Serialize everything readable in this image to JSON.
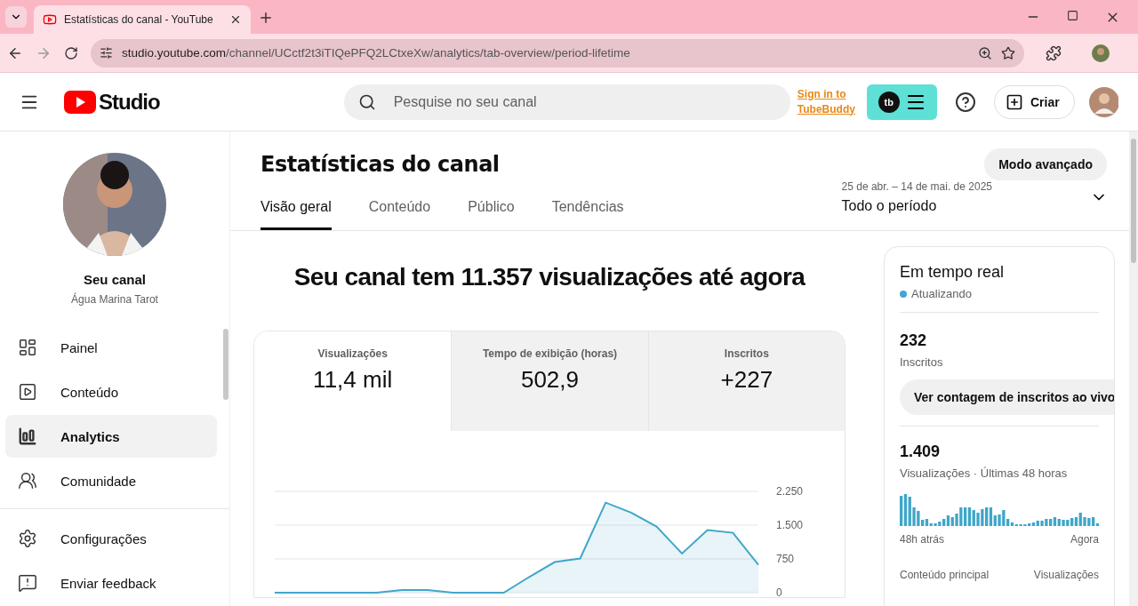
{
  "browser": {
    "tab_title": "Estatísticas do canal - YouTube",
    "url_host": "studio.youtube.com",
    "url_path": "/channel/UCctf2t3iTIQePFQ2LCtxeXw/analytics/tab-overview/period-lifetime"
  },
  "header": {
    "logo_text": "Studio",
    "search_placeholder": "Pesquise no seu canal",
    "tubebuddy_link": "Sign in to TubeBuddy",
    "tubebuddy_badge": "tb",
    "create_button": "Criar"
  },
  "sidebar": {
    "channel_title": "Seu canal",
    "channel_name": "Água Marina Tarot",
    "items": [
      {
        "label": "Painel",
        "selected": false
      },
      {
        "label": "Conteúdo",
        "selected": false
      },
      {
        "label": "Analytics",
        "selected": true
      },
      {
        "label": "Comunidade",
        "selected": false
      }
    ],
    "footer_items": [
      {
        "label": "Configurações"
      },
      {
        "label": "Enviar feedback"
      }
    ]
  },
  "page": {
    "title": "Estatísticas do canal",
    "advanced_button": "Modo avançado",
    "tabs": [
      {
        "label": "Visão geral",
        "selected": true
      },
      {
        "label": "Conteúdo",
        "selected": false
      },
      {
        "label": "Público",
        "selected": false
      },
      {
        "label": "Tendências",
        "selected": false
      }
    ],
    "period": {
      "range": "25 de abr. – 14 de mai. de 2025",
      "label": "Todo o período"
    },
    "headline": "Seu canal tem 11.357 visualizações até agora",
    "metrics": [
      {
        "label": "Visualizações",
        "value": "11,4 mil",
        "selected": true
      },
      {
        "label": "Tempo de exibição (horas)",
        "value": "502,9",
        "selected": false
      },
      {
        "label": "Inscritos",
        "value": "+227",
        "selected": false
      }
    ],
    "chart_data": {
      "type": "area",
      "yticks": [
        {
          "value": 0,
          "label": "0"
        },
        {
          "value": 750,
          "label": "750"
        },
        {
          "value": 1500,
          "label": "1.500"
        },
        {
          "value": 2250,
          "label": "2.250"
        }
      ],
      "ylim": [
        0,
        2250
      ],
      "series": [
        {
          "color": "#41a6c9",
          "values": [
            0,
            0,
            0,
            0,
            0,
            60,
            60,
            0,
            0,
            0,
            350,
            680,
            760,
            2000,
            1780,
            1470,
            870,
            1390,
            1330,
            620
          ]
        }
      ]
    }
  },
  "realtime": {
    "title": "Em tempo real",
    "status": "Atualizando",
    "subscribers": "232",
    "subscribers_label": "Inscritos",
    "live_button": "Ver contagem de inscritos ao vivo",
    "views": "1.409",
    "views_label": "Visualizações · Últimas 48 horas",
    "axis_start": "48h atrás",
    "axis_end": "Agora",
    "column_1": "Conteúdo principal",
    "column_2": "Visualizações"
  }
}
